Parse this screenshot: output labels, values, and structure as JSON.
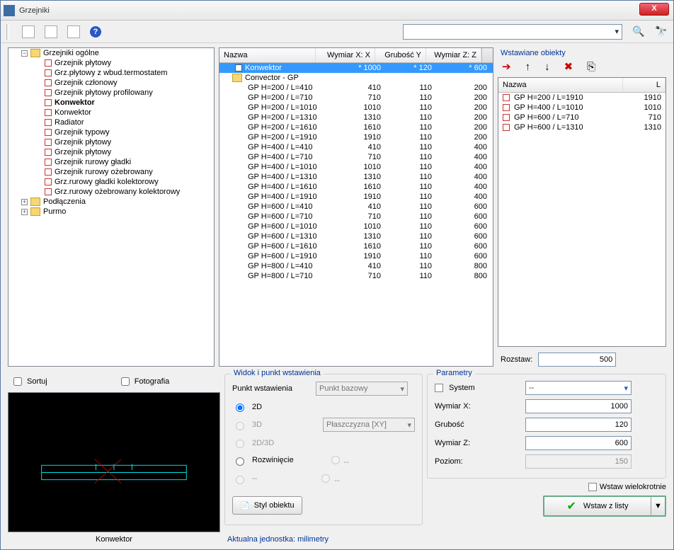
{
  "window": {
    "title": "Grzejniki",
    "close": "X"
  },
  "toolbar": {
    "help": "?"
  },
  "tree": {
    "root": "Grzejniki ogólne",
    "items": [
      "Grzejnik płytowy",
      "Grz.płytowy z wbud.termostatem",
      "Grzejnik członowy",
      "Grzejnik płytowy profilowany",
      "Konwektor",
      "Konwektor",
      "Radiator",
      "Grzejnik typowy",
      "Grzejnik płytowy",
      "Grzejnik płytowy",
      "Grzejnik rurowy gładki",
      "Grzejnik rurowy ożebrowany",
      "Grz.rurowy gładki kolektorowy",
      "Grz.rurowy ożebrowany kolektorowy"
    ],
    "bold_index": 4,
    "sub1": "Podłączenia",
    "sub2": "Purmo"
  },
  "grid": {
    "headers": {
      "name": "Nazwa",
      "x": "Wymiar X: X",
      "y": "Grubość Y",
      "z": "Wymiar Z: Z"
    },
    "selected": {
      "name": "Konwektor",
      "x": "* 1000",
      "y": "* 120",
      "z": "* 600"
    },
    "group": "Convector - GP",
    "rows": [
      {
        "n": "GP H=200 / L=410",
        "x": "410",
        "y": "110",
        "z": "200"
      },
      {
        "n": "GP H=200 / L=710",
        "x": "710",
        "y": "110",
        "z": "200"
      },
      {
        "n": "GP H=200 / L=1010",
        "x": "1010",
        "y": "110",
        "z": "200"
      },
      {
        "n": "GP H=200 / L=1310",
        "x": "1310",
        "y": "110",
        "z": "200"
      },
      {
        "n": "GP H=200 / L=1610",
        "x": "1610",
        "y": "110",
        "z": "200"
      },
      {
        "n": "GP H=200 / L=1910",
        "x": "1910",
        "y": "110",
        "z": "200"
      },
      {
        "n": "GP H=400 / L=410",
        "x": "410",
        "y": "110",
        "z": "400"
      },
      {
        "n": "GP H=400 / L=710",
        "x": "710",
        "y": "110",
        "z": "400"
      },
      {
        "n": "GP H=400 / L=1010",
        "x": "1010",
        "y": "110",
        "z": "400"
      },
      {
        "n": "GP H=400 / L=1310",
        "x": "1310",
        "y": "110",
        "z": "400"
      },
      {
        "n": "GP H=400 / L=1610",
        "x": "1610",
        "y": "110",
        "z": "400"
      },
      {
        "n": "GP H=400 / L=1910",
        "x": "1910",
        "y": "110",
        "z": "400"
      },
      {
        "n": "GP H=600 / L=410",
        "x": "410",
        "y": "110",
        "z": "600"
      },
      {
        "n": "GP H=600 / L=710",
        "x": "710",
        "y": "110",
        "z": "600"
      },
      {
        "n": "GP H=600 / L=1010",
        "x": "1010",
        "y": "110",
        "z": "600"
      },
      {
        "n": "GP H=600 / L=1310",
        "x": "1310",
        "y": "110",
        "z": "600"
      },
      {
        "n": "GP H=600 / L=1610",
        "x": "1610",
        "y": "110",
        "z": "600"
      },
      {
        "n": "GP H=600 / L=1910",
        "x": "1910",
        "y": "110",
        "z": "600"
      },
      {
        "n": "GP H=800 / L=410",
        "x": "410",
        "y": "110",
        "z": "800"
      },
      {
        "n": "GP H=800 / L=710",
        "x": "710",
        "y": "110",
        "z": "800"
      }
    ]
  },
  "objects": {
    "title": "Wstawiane obiekty",
    "headers": {
      "name": "Nazwa",
      "l": "L"
    },
    "rows": [
      {
        "n": "GP H=200 / L=1910",
        "l": "1910"
      },
      {
        "n": "GP H=400 / L=1010",
        "l": "1010"
      },
      {
        "n": "GP H=600 / L=710",
        "l": "710"
      },
      {
        "n": "GP H=600 / L=1310",
        "l": "1310"
      }
    ],
    "rozstaw_label": "Rozstaw:",
    "rozstaw_value": "500"
  },
  "sort": {
    "sort": "Sortuj",
    "foto": "Fotografia",
    "caption": "Konwektor"
  },
  "view": {
    "legend": "Widok i punkt wstawienia",
    "punkt": "Punkt wstawienia",
    "punkt_sel": "Punkt bazowy",
    "o2d": "2D",
    "o3d": "3D",
    "plane": "Płaszczyzna  [XY]",
    "o23": "2D/3D",
    "rozw": "Rozwinięcie",
    "dash": "--",
    "styl": "Styl obiektu",
    "unit": "Aktualna jednostka: milimetry"
  },
  "params": {
    "legend": "Parametry",
    "system": "System",
    "system_sel": "--",
    "x": "Wymiar X:",
    "xval": "1000",
    "g": "Grubość",
    "gval": "120",
    "z": "Wymiar Z:",
    "zval": "600",
    "p": "Poziom:",
    "pval": "150",
    "multi": "Wstaw wielokrotnie",
    "insert": "Wstaw z listy"
  }
}
